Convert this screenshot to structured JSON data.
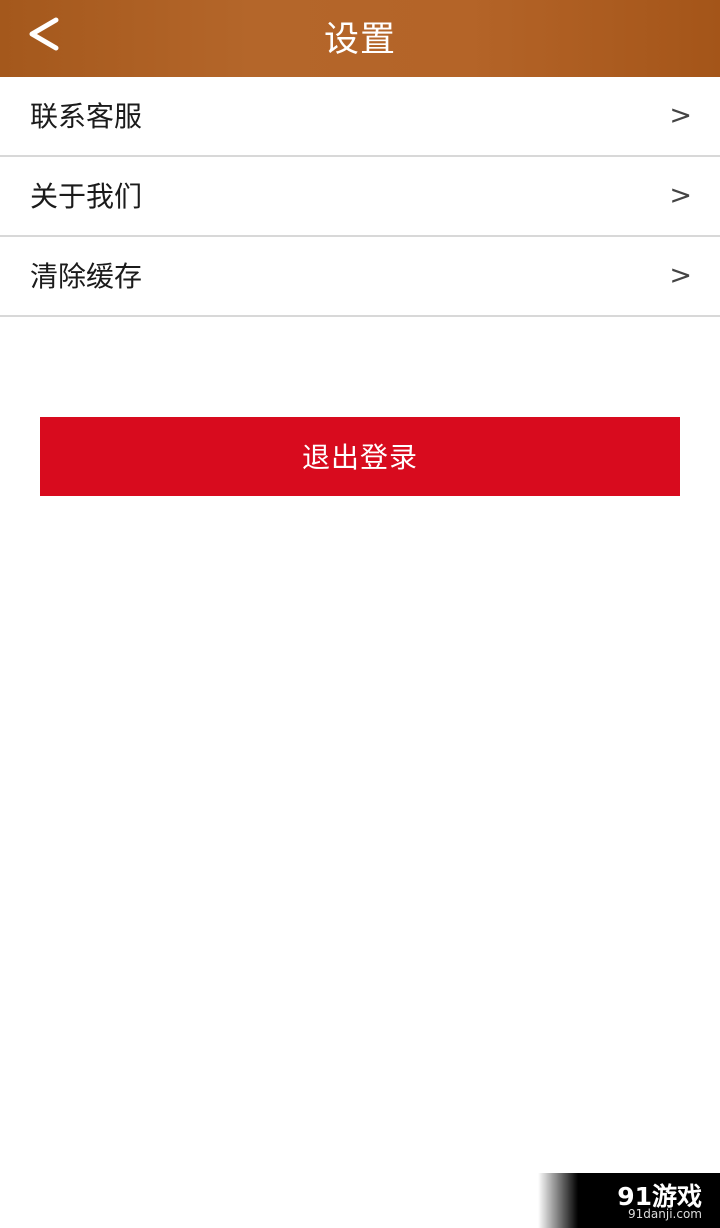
{
  "header": {
    "title": "设置",
    "back_icon": "chevron-left-icon",
    "background_color": "#ab5c20"
  },
  "menu": {
    "items": [
      {
        "label": "联系客服",
        "chevron": ">"
      },
      {
        "label": "关于我们",
        "chevron": ">"
      },
      {
        "label": "清除缓存",
        "chevron": ">"
      }
    ]
  },
  "logout": {
    "label": "退出登录",
    "color": "#d80b1e"
  },
  "watermark": {
    "logo_text": "91游戏",
    "url": "91danji.com"
  }
}
